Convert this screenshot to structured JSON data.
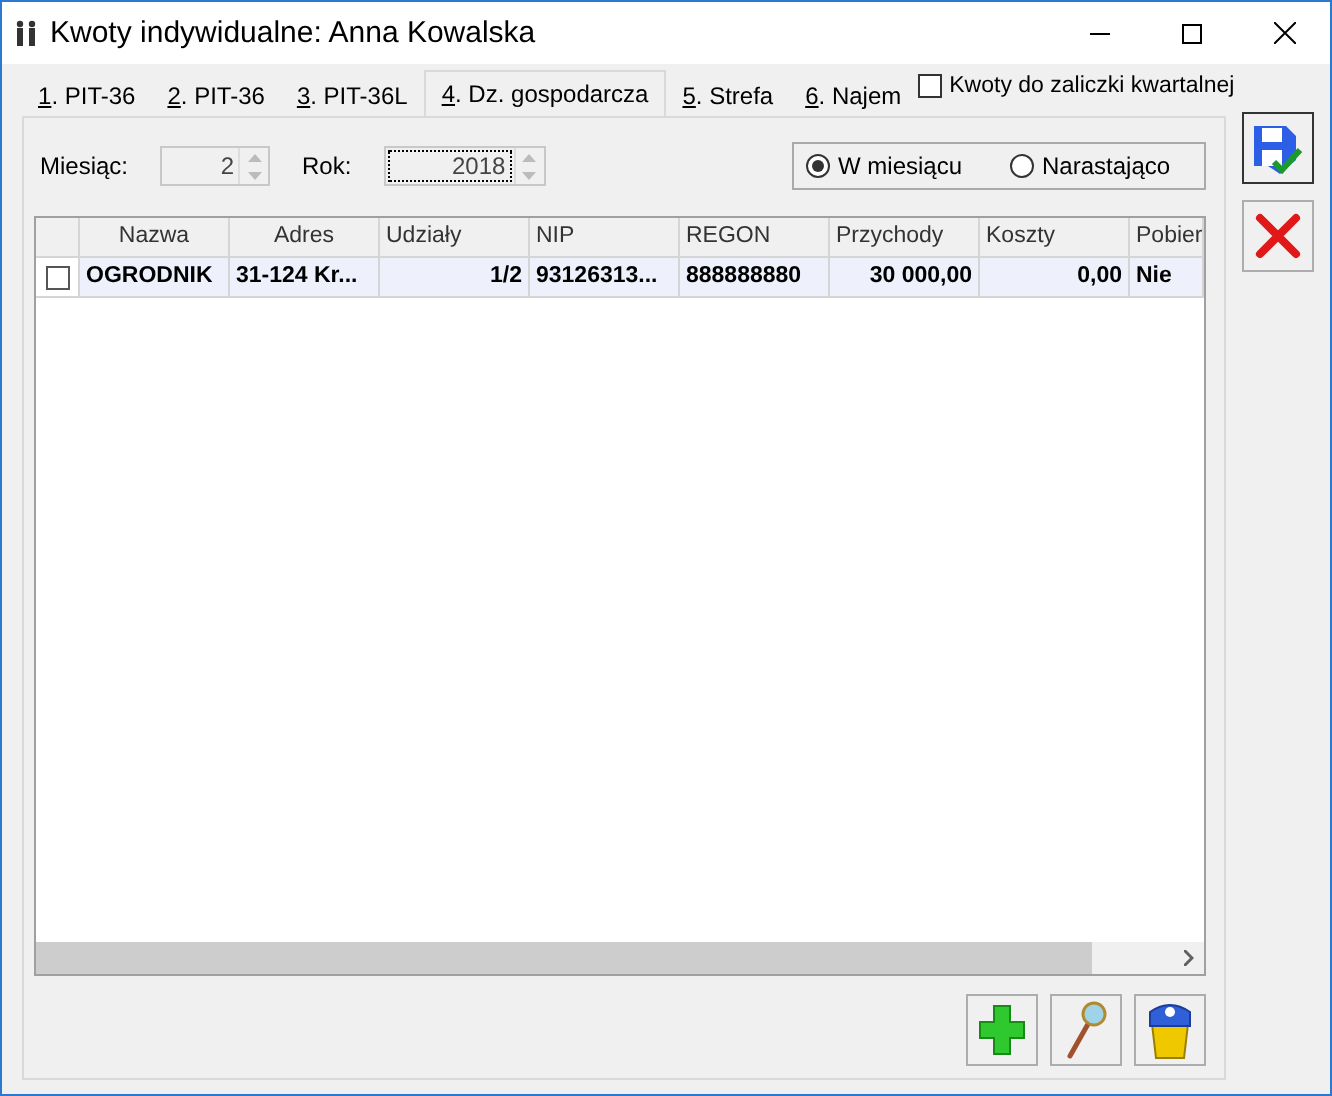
{
  "window": {
    "title": "Kwoty indywidualne: Anna Kowalska"
  },
  "tabs": [
    {
      "key": "1",
      "label": ". PIT-36",
      "selected": false
    },
    {
      "key": "2",
      "label": ". PIT-36",
      "selected": false
    },
    {
      "key": "3",
      "label": ". PIT-36L",
      "selected": false
    },
    {
      "key": "4",
      "label": ". Dz. gospodarcza",
      "selected": true
    },
    {
      "key": "5",
      "label": ". Strefa",
      "selected": false
    },
    {
      "key": "6",
      "label": ". Najem",
      "selected": false
    }
  ],
  "quarterly": {
    "label": "Kwoty do zaliczki kwartalnej",
    "checked": false
  },
  "filters": [
    {
      "label": "Miesiąc:",
      "value": "2",
      "focused": false
    },
    {
      "label": "Rok:",
      "value": "2018",
      "focused": true
    }
  ],
  "period": [
    {
      "label": "W miesiącu",
      "selected": true
    },
    {
      "label": "Narastająco",
      "selected": false
    }
  ],
  "table": {
    "columns": [
      {
        "label": "Nazwa",
        "kind": "text"
      },
      {
        "label": "Adres",
        "kind": "text"
      },
      {
        "label": "Udziały",
        "kind": "number"
      },
      {
        "label": "NIP",
        "kind": "text"
      },
      {
        "label": "REGON",
        "kind": "text"
      },
      {
        "label": "Przychody",
        "kind": "number"
      },
      {
        "label": "Koszty",
        "kind": "number"
      },
      {
        "label": "Pobier",
        "kind": "text"
      }
    ],
    "rows": [
      {
        "checked": false,
        "selected": true,
        "cells": [
          "OGRODNIK",
          "31-124 Kr...",
          "1/2",
          "93126313...",
          "888888880",
          "30 000,00",
          "0,00",
          "Nie"
        ]
      }
    ]
  }
}
